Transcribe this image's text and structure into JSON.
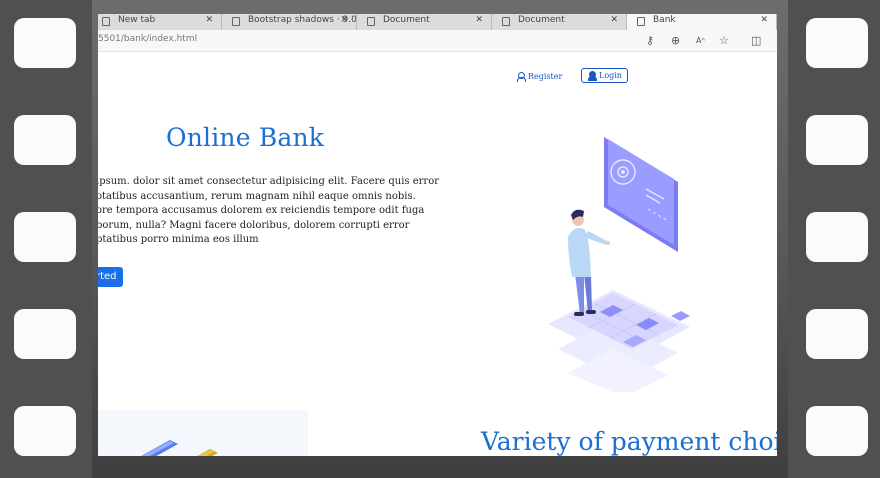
{
  "browser": {
    "tabs": [
      {
        "title": "New tab",
        "active": false
      },
      {
        "title": "Bootstrap shadows · 9.0 els",
        "active": false
      },
      {
        "title": "Document",
        "active": false
      },
      {
        "title": "Document",
        "active": false
      },
      {
        "title": "Bank",
        "active": true
      }
    ],
    "url": "5501/bank/index.html",
    "toolbar_icons": [
      "key-icon",
      "zoom-icon",
      "read-aloud-icon",
      "favorite-icon",
      "split-screen-icon"
    ]
  },
  "page": {
    "nav": {
      "register_label": "Register",
      "login_label": "Login"
    },
    "hero": {
      "title": "Online Bank",
      "lines": [
        "ipsum. dolor sit amet consectetur adipisicing elit. Facere quis error",
        "otatibus accusantium, rerum magnam nihil eaque omnis nobis.",
        "ore tempora accusamus dolorem ex reiciendis tempore odit fuga",
        "borum, nulla? Magni facere doloribus, dolorem corrupti error",
        "ptatibus porro minima eos illum"
      ],
      "cta_label": "rted"
    },
    "section_title": "Variety of payment choic"
  },
  "colors": {
    "accent": "#1a6fd1",
    "button": "#1a6fe8",
    "illustration": "#6f6ff0"
  }
}
